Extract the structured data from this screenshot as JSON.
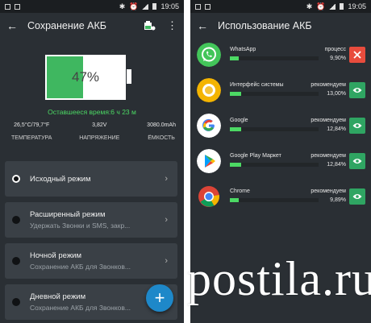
{
  "left": {
    "status": {
      "time": "19:05"
    },
    "appbar": {
      "title": "Сохранение АКБ"
    },
    "battery": {
      "percent_label": "47%",
      "level": 0.47,
      "remaining": "Оставшееся время:6 ч 23 м"
    },
    "stats": [
      {
        "value": "26,5°C/79,7°F",
        "label": "ТЕМПЕРАТУРА"
      },
      {
        "value": "3,82V",
        "label": "НАПРЯЖЕНИЕ"
      },
      {
        "value": "3080.0mAh",
        "label": "ЁМКОСТЬ"
      }
    ],
    "modes": [
      {
        "name": "Исходный режим",
        "desc": "",
        "selected": true
      },
      {
        "name": "Расширенный режим",
        "desc": "Удержать Звонки и SMS, закр...",
        "selected": false
      },
      {
        "name": "Ночной режим",
        "desc": "Сохранение АКБ для Звонков...",
        "selected": false
      },
      {
        "name": "Дневной режим",
        "desc": "Сохранение АКБ для Звонков...",
        "selected": false
      }
    ],
    "fab_label": "+"
  },
  "right": {
    "status": {
      "time": "19:05"
    },
    "appbar": {
      "title": "Использование АКБ"
    },
    "apps": [
      {
        "name": "WhatsApp",
        "status": "процесс",
        "pct": "9,90%",
        "level": 0.099,
        "button": "close-icon",
        "button_color": "#e84c3d"
      },
      {
        "name": "Интерфейс системы",
        "status": "рекомендуем",
        "pct": "13,00%",
        "level": 0.13,
        "button": "eye-icon",
        "button_color": "#2fa562"
      },
      {
        "name": "Google",
        "status": "рекомендуем",
        "pct": "12,84%",
        "level": 0.1284,
        "button": "eye-icon",
        "button_color": "#2fa562"
      },
      {
        "name": "Google Play Маркет",
        "status": "рекомендуем",
        "pct": "12,84%",
        "level": 0.1284,
        "button": "eye-icon",
        "button_color": "#2fa562"
      },
      {
        "name": "Chrome",
        "status": "рекомендуем",
        "pct": "9,89%",
        "level": 0.0989,
        "button": "eye-icon",
        "button_color": "#2fa562"
      }
    ]
  },
  "colors": {
    "accent_green": "#4cd964",
    "battery_fill": "#3fb760",
    "fab_blue": "#1e88c9",
    "background": "#2a2f34"
  },
  "watermark": "postila.ru"
}
